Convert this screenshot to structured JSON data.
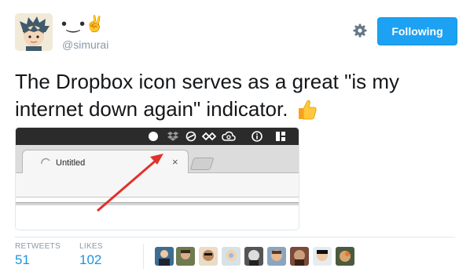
{
  "author": {
    "name_emoji": "•‿•✌",
    "handle": "@simurai"
  },
  "actions": {
    "follow_label": "Following"
  },
  "tweet": {
    "text": "The Dropbox icon serves as a great \"is my internet down again\" indicator."
  },
  "screenshot": {
    "tab_title": "Untitled",
    "tab_close": "×"
  },
  "stats": {
    "retweets_label": "RETWEETS",
    "retweets_count": "51",
    "likes_label": "LIKES",
    "likes_count": "102"
  },
  "colors": {
    "follow_button": "#1da1f2",
    "count_text": "#1b95e0",
    "handle_text": "#8899a6",
    "arrow": "#e0322b"
  },
  "icons": [
    "avatar",
    "gear-icon",
    "thumbs-up-icon",
    "dropbox-icon",
    "arrow-annotation"
  ]
}
